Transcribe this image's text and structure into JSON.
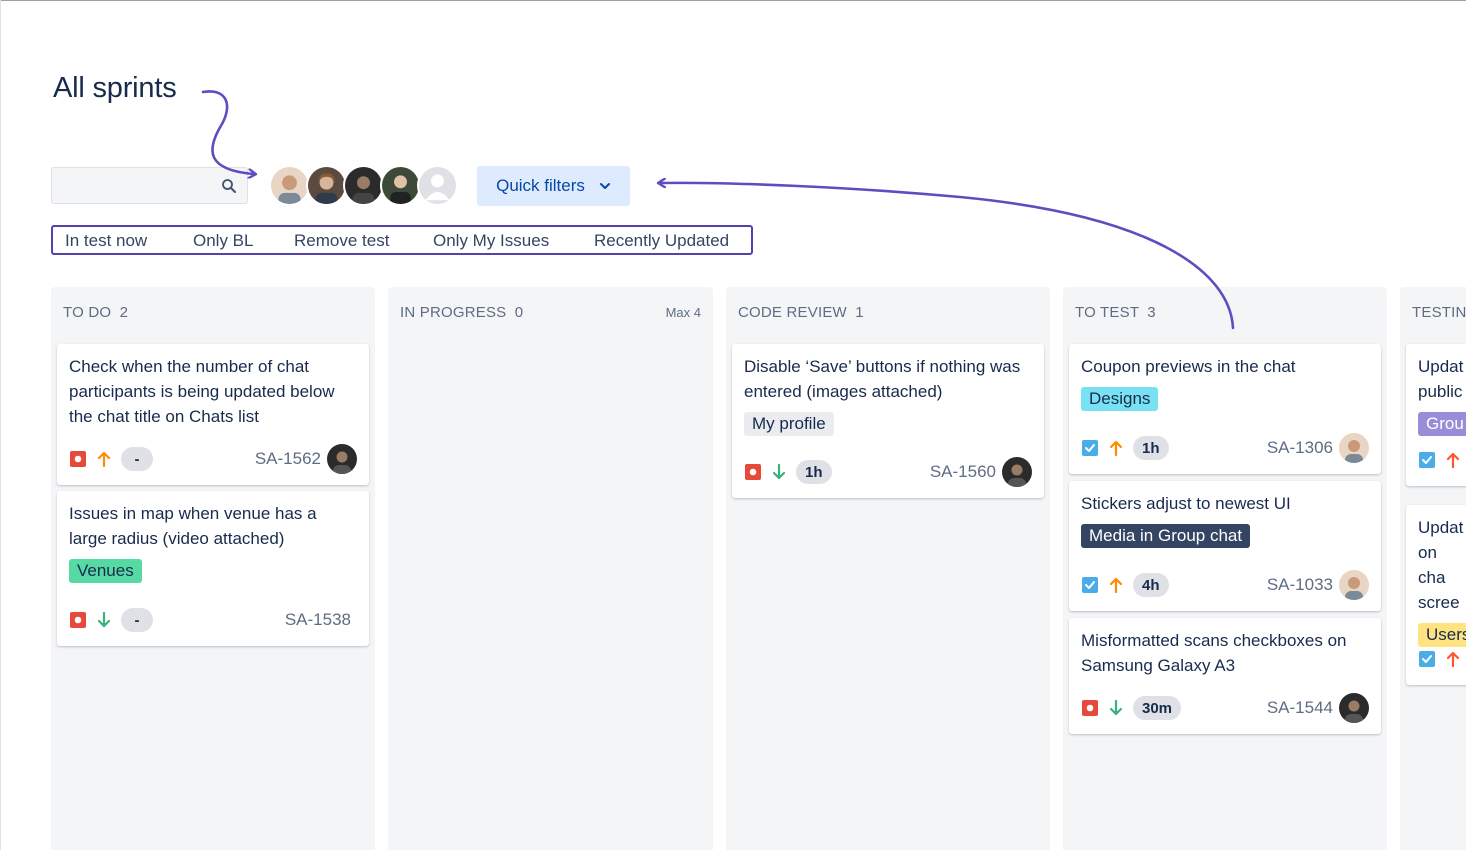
{
  "page": {
    "title": "All sprints"
  },
  "search": {
    "placeholder": ""
  },
  "quick_filters": {
    "label": "Quick filters"
  },
  "avatars": [
    "avatar-1",
    "avatar-2",
    "avatar-3",
    "avatar-4",
    "avatar-unassigned"
  ],
  "filters": [
    "In test now",
    "Only BL",
    "Remove test",
    "Only My Issues",
    "Recently Updated"
  ],
  "colors": {
    "accent": "#5243aa",
    "column_bg": "#f4f5f7",
    "bug": "#de350b",
    "task": "#2684ff",
    "priority_high": "#ff5630",
    "priority_med": "#ff8b00",
    "priority_low": "#36b37e"
  },
  "columns": [
    {
      "name": "TO DO",
      "count": "2",
      "max": "",
      "cards": [
        {
          "title": "Check when the number of chat participants is being updated below the chat title on Chats list",
          "label": "",
          "type": "bug",
          "priority": "up-orange",
          "estimate": "-",
          "key": "SA-1562",
          "assignee": true
        },
        {
          "title": "Issues in map when venue has a large radius (video attached)",
          "label": "Venues",
          "type": "bug",
          "priority": "down-green",
          "estimate": "-",
          "key": "SA-1538",
          "assignee": false
        }
      ]
    },
    {
      "name": "IN PROGRESS",
      "count": "0",
      "max": "Max 4",
      "cards": []
    },
    {
      "name": "CODE REVIEW",
      "count": "1",
      "max": "",
      "cards": [
        {
          "title": "Disable ‘Save’ buttons if nothing was entered (images attached)",
          "label": "My profile",
          "type": "bug",
          "priority": "down-green",
          "estimate": "1h",
          "key": "SA-1560",
          "assignee": true
        }
      ]
    },
    {
      "name": "TO TEST",
      "count": "3",
      "max": "",
      "cards": [
        {
          "title": "Coupon previews in the chat",
          "label": "Designs",
          "type": "task",
          "priority": "up-orange",
          "estimate": "1h",
          "key": "SA-1306",
          "assignee": true
        },
        {
          "title": "Stickers adjust to newest UI",
          "label": "Media in Group chat",
          "type": "task",
          "priority": "up-orange",
          "estimate": "4h",
          "key": "SA-1033",
          "assignee": true
        },
        {
          "title": "Misformatted scans checkboxes on Samsung Galaxy A3",
          "label": "",
          "type": "bug",
          "priority": "down-green",
          "estimate": "30m",
          "key": "SA-1544",
          "assignee": true
        }
      ]
    },
    {
      "name": "TESTING",
      "count": "",
      "max": "",
      "cards": [
        {
          "title": "Updat public",
          "label": "Grou",
          "type": "task",
          "priority": "up-red"
        },
        {
          "title": "Updat on cha scree",
          "label": "Users",
          "type": "task",
          "priority": "up-red"
        }
      ]
    }
  ]
}
